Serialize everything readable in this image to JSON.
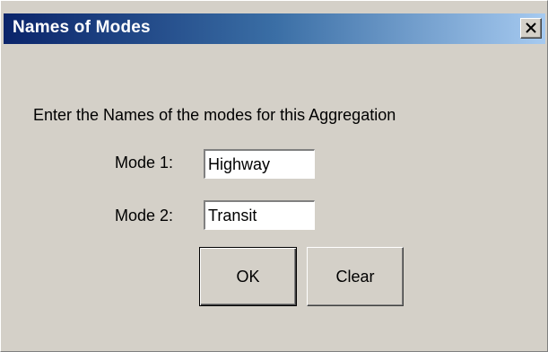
{
  "window": {
    "title": "Names of Modes",
    "close_icon": "close-x-icon"
  },
  "instruction": "Enter the Names of the modes for this Aggregation",
  "modes": [
    {
      "label": "Mode 1:",
      "value": "Highway"
    },
    {
      "label": "Mode 2:",
      "value": "Transit"
    }
  ],
  "buttons": {
    "ok_label": "OK",
    "clear_label": "Clear"
  },
  "colors": {
    "titlebar_start": "#0a246a",
    "titlebar_end": "#a6caf0",
    "dialog_bg": "#d4d0c8"
  }
}
